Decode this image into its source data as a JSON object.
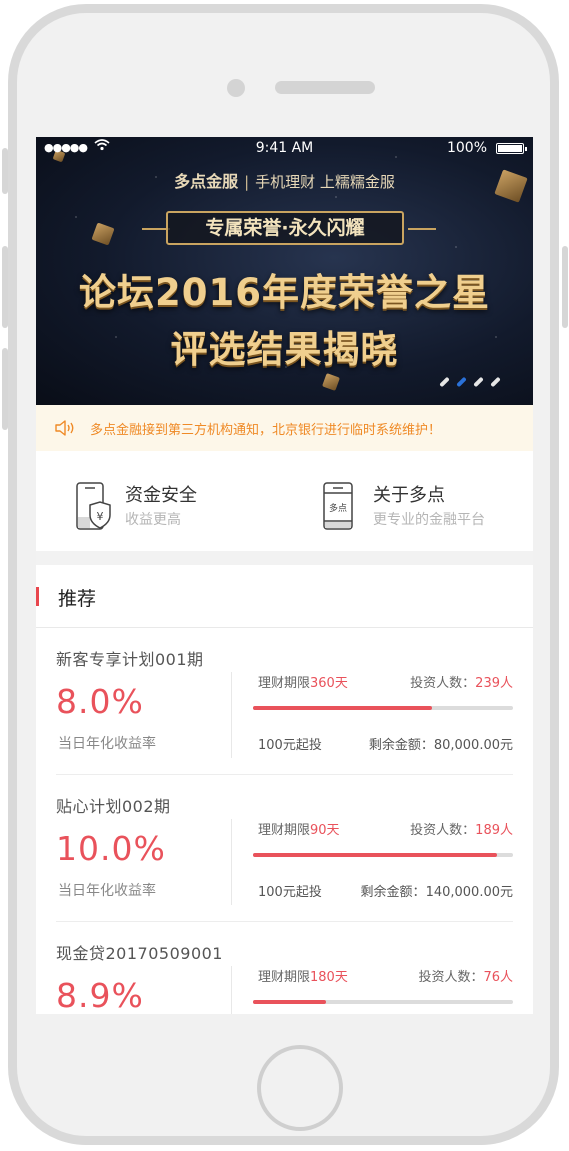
{
  "status_bar": {
    "signal": "●●●●●",
    "time": "9:41 AM",
    "battery": "100%"
  },
  "banner": {
    "brand": "多点金服",
    "brand_sub": "手机理财 上糯糯金服",
    "tag": "专属荣誉·永久闪耀",
    "headline_1": "论坛2016年度荣誉之星",
    "headline_2": "评选结果揭晓",
    "slides_total": 4,
    "slide_active": 2
  },
  "notice": {
    "text": "多点金融接到第三方机构通知，北京银行进行临时系统维护！",
    "color": "#ef8a26"
  },
  "features": [
    {
      "title": "资金安全",
      "subtitle": "收益更高",
      "icon": "phone-shield-icon"
    },
    {
      "title": "关于多点",
      "subtitle": "更专业的金融平台",
      "icon": "phone-logo-icon"
    }
  ],
  "recommend": {
    "title": "推荐",
    "accent": "#e8464d",
    "products": [
      {
        "name": "新客专享计划001期",
        "rate": "8.0%",
        "rate_label": "当日年化收益率",
        "term_label": "理财期限",
        "term_value": "360天",
        "investors_label": "投资人数：",
        "investors_value": "239人",
        "progress": 0.69,
        "min_invest": "100元起投",
        "remaining_label": "剩余金额：",
        "remaining_value": "80,000.00元"
      },
      {
        "name": "贴心计划002期",
        "rate": "10.0%",
        "rate_label": "当日年化收益率",
        "term_label": "理财期限",
        "term_value": "90天",
        "investors_label": "投资人数：",
        "investors_value": "189人",
        "progress": 0.94,
        "min_invest": "100元起投",
        "remaining_label": "剩余金额：",
        "remaining_value": "140,000.00元"
      },
      {
        "name": "现金贷20170509001",
        "rate": "8.9%",
        "rate_label": "",
        "term_label": "理财期限",
        "term_value": "180天",
        "investors_label": "投资人数：",
        "investors_value": "76人",
        "progress": 0.28,
        "min_invest": "",
        "remaining_label": "",
        "remaining_value": ""
      }
    ]
  }
}
